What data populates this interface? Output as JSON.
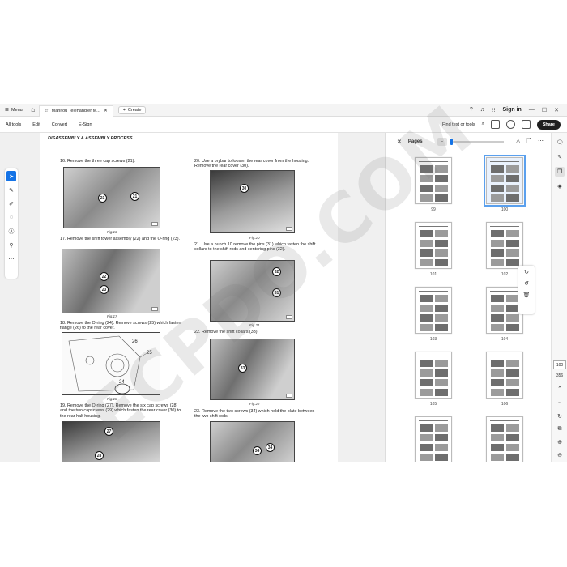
{
  "tabs": {
    "menu_label": "Menu",
    "doc_title": "Manitou Telehandler M...",
    "create_label": "Create",
    "sign_in": "Sign in"
  },
  "toolbar": {
    "all_tools": "All tools",
    "edit": "Edit",
    "convert": "Convert",
    "esign": "E-Sign",
    "find": "Find text or tools",
    "share": "Share"
  },
  "document": {
    "header": "DISASSEMBLY & ASSEMBLY PROCESS",
    "left_column": [
      {
        "text": "16. Remove the three cap screws (21).",
        "caption": "Fig.16",
        "callouts": [
          "21",
          "21"
        ]
      },
      {
        "text": "17. Remove the shift tower assembly (22) and the O-ring (23).",
        "caption": "Fig.17",
        "callouts": [
          "22",
          "23"
        ]
      },
      {
        "text": "18. Remove the O-ring (24). Remove screws (25) which fasten flange (26) to the rear cover.",
        "caption": "Fig.18",
        "callouts": [
          "26",
          "25",
          "24"
        ]
      },
      {
        "text": "19. Remove the O-ring (27). Remove the six cap screws (28) and the two capscrews (29) which fasten the rear cover (30) to the rear half housing.",
        "caption": "",
        "callouts": [
          "27",
          "28"
        ]
      }
    ],
    "right_column": [
      {
        "text": "20. Use a prybar to loosen the rear cover from the housing. Remove the rear cover (30).",
        "caption": "Fig.20",
        "callouts": [
          "30"
        ]
      },
      {
        "text": "21. Use a punch 10 remove the pins (31) which fasten the shift collars to the shift rods and centering pins (32).",
        "caption": "Fig.21",
        "callouts": [
          "32",
          "31"
        ]
      },
      {
        "text": "22. Remove the shift collars (33).",
        "caption": "Fig.22",
        "callouts": [
          "33"
        ]
      },
      {
        "text": "23. Remove the two screws (34) which hold the plate between the two shift rods.",
        "caption": "",
        "callouts": [
          "34",
          "34"
        ]
      }
    ]
  },
  "pages_panel": {
    "title": "Pages",
    "thumbnails": [
      "99",
      "100",
      "101",
      "102",
      "103",
      "104",
      "105",
      "106",
      "",
      ""
    ],
    "selected": "100"
  },
  "page_indicator": {
    "current": "100",
    "total": "356"
  },
  "watermark": "ECPDO.COM",
  "colors": {
    "accent": "#1473e6",
    "share_bg": "#1f1f1f"
  }
}
